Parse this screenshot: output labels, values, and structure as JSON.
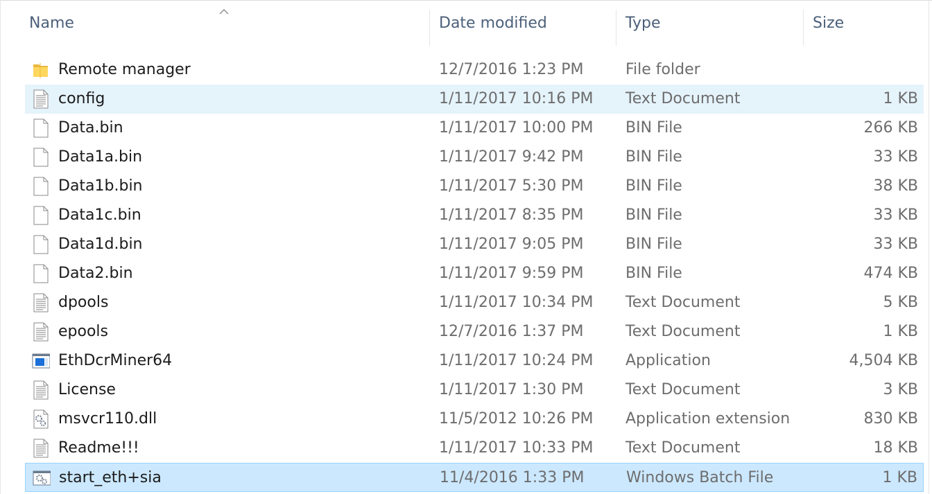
{
  "columns": {
    "name": "Name",
    "date_modified": "Date modified",
    "type": "Type",
    "size": "Size"
  },
  "sort": {
    "column": "Name",
    "direction": "ascending"
  },
  "files": [
    {
      "name": "Remote manager",
      "date": "12/7/2016 1:23 PM",
      "type": "File folder",
      "size": "",
      "icon": "folder-icon",
      "state": "normal"
    },
    {
      "name": "config",
      "date": "1/11/2017 10:16 PM",
      "type": "Text Document",
      "size": "1 KB",
      "icon": "text-file-icon",
      "state": "hover"
    },
    {
      "name": "Data.bin",
      "date": "1/11/2017 10:00 PM",
      "type": "BIN File",
      "size": "266 KB",
      "icon": "blank-file-icon",
      "state": "normal"
    },
    {
      "name": "Data1a.bin",
      "date": "1/11/2017 9:42 PM",
      "type": "BIN File",
      "size": "33 KB",
      "icon": "blank-file-icon",
      "state": "normal"
    },
    {
      "name": "Data1b.bin",
      "date": "1/11/2017 5:30 PM",
      "type": "BIN File",
      "size": "38 KB",
      "icon": "blank-file-icon",
      "state": "normal"
    },
    {
      "name": "Data1c.bin",
      "date": "1/11/2017 8:35 PM",
      "type": "BIN File",
      "size": "33 KB",
      "icon": "blank-file-icon",
      "state": "normal"
    },
    {
      "name": "Data1d.bin",
      "date": "1/11/2017 9:05 PM",
      "type": "BIN File",
      "size": "33 KB",
      "icon": "blank-file-icon",
      "state": "normal"
    },
    {
      "name": "Data2.bin",
      "date": "1/11/2017 9:59 PM",
      "type": "BIN File",
      "size": "474 KB",
      "icon": "blank-file-icon",
      "state": "normal"
    },
    {
      "name": "dpools",
      "date": "1/11/2017 10:34 PM",
      "type": "Text Document",
      "size": "5 KB",
      "icon": "text-file-icon",
      "state": "normal"
    },
    {
      "name": "epools",
      "date": "12/7/2016 1:37 PM",
      "type": "Text Document",
      "size": "1 KB",
      "icon": "text-file-icon",
      "state": "normal"
    },
    {
      "name": "EthDcrMiner64",
      "date": "1/11/2017 10:24 PM",
      "type": "Application",
      "size": "4,504 KB",
      "icon": "application-icon",
      "state": "normal"
    },
    {
      "name": "License",
      "date": "1/11/2017 1:30 PM",
      "type": "Text Document",
      "size": "3 KB",
      "icon": "text-file-icon",
      "state": "normal"
    },
    {
      "name": "msvcr110.dll",
      "date": "11/5/2012 10:26 PM",
      "type": "Application extension",
      "size": "830 KB",
      "icon": "dll-gear-icon",
      "state": "normal"
    },
    {
      "name": "Readme!!!",
      "date": "1/11/2017 10:33 PM",
      "type": "Text Document",
      "size": "18 KB",
      "icon": "text-file-icon",
      "state": "normal"
    },
    {
      "name": "start_eth+sia",
      "date": "11/4/2016 1:33 PM",
      "type": "Windows Batch File",
      "size": "1 KB",
      "icon": "batch-gear-icon",
      "state": "selected"
    }
  ],
  "colors": {
    "header_text": "#4c607a",
    "hover_bg": "#e5f3fb",
    "selected_bg": "#cce8ff",
    "selected_border": "#99d1ff",
    "meta_text": "#6d6d6d",
    "folder": "#ffd75e"
  }
}
